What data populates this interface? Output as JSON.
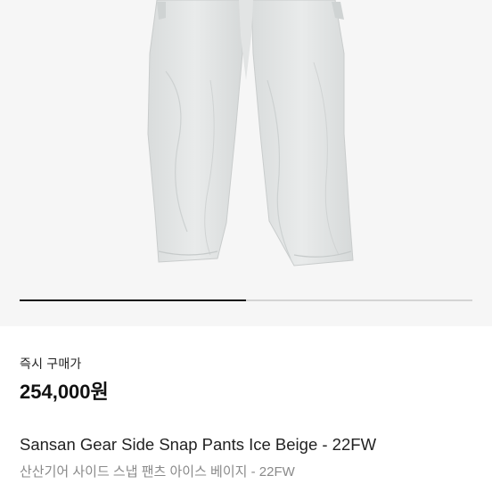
{
  "product": {
    "image_alt": "Sansan Gear Side Snap Pants Ice Beige",
    "image_indicator_fraction": 0.5,
    "buy_label": "즉시 구매가",
    "price": "254,000원",
    "name_en": "Sansan Gear Side Snap Pants Ice Beige - 22FW",
    "name_ko": "산산기어 사이드 스냅 팬츠 아이스 베이지 - 22FW"
  },
  "colors": {
    "image_background": "#f6f6f6",
    "pants_fill": "#e4e6e6",
    "indicator_active": "#111111",
    "indicator_track": "#d4d4d4"
  }
}
